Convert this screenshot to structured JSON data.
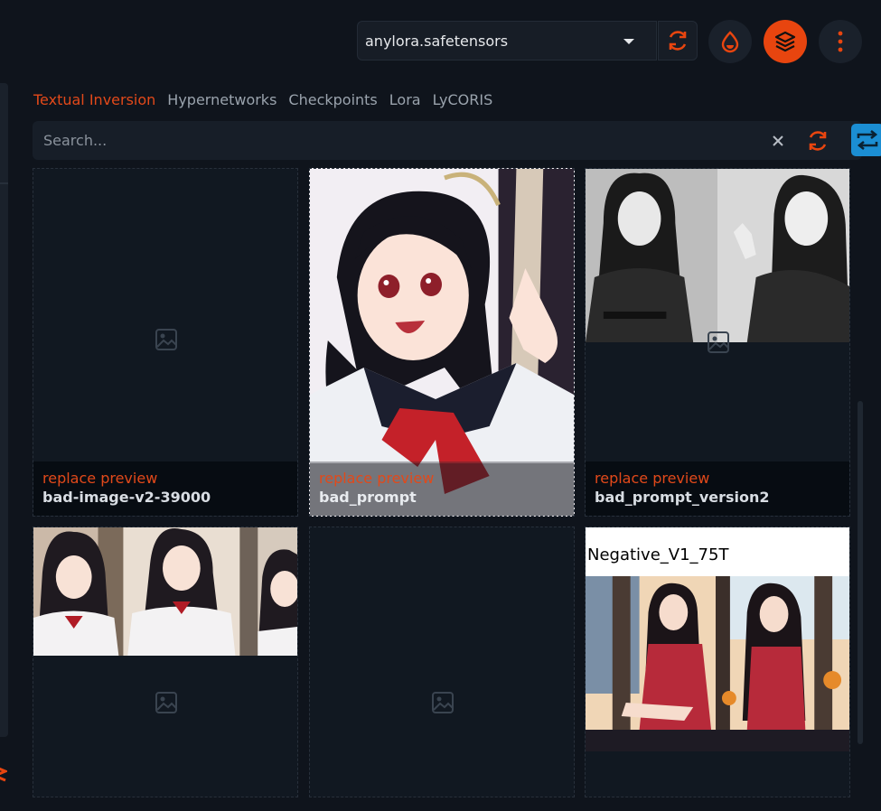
{
  "header": {
    "model_value": "anylora.safetensors",
    "model_refresh_icon": "refresh-icon",
    "buttons": [
      {
        "icon": "droplet-icon",
        "active": false
      },
      {
        "icon": "layers-icon",
        "active": true
      },
      {
        "icon": "more-vertical-icon",
        "active": false
      }
    ]
  },
  "tabs": [
    {
      "label": "Textual Inversion",
      "active": true
    },
    {
      "label": "Hypernetworks",
      "active": false
    },
    {
      "label": "Checkpoints",
      "active": false
    },
    {
      "label": "Lora",
      "active": false
    },
    {
      "label": "LyCORIS",
      "active": false
    }
  ],
  "search": {
    "placeholder": "Search...",
    "value": ""
  },
  "cards": [
    {
      "replace_label": "replace preview",
      "title": "bad-image-v2-39000"
    },
    {
      "replace_label": "replace preview",
      "title": "bad_prompt"
    },
    {
      "replace_label": "replace preview",
      "title": "bad_prompt_version2"
    },
    {
      "replace_label": "",
      "title": ""
    },
    {
      "replace_label": "",
      "title": ""
    },
    {
      "replace_label": "",
      "title": "",
      "image_caption": "Negative_V1_75T"
    }
  ],
  "colors": {
    "accent": "#e2491a",
    "sort_button": "#1b8ed3",
    "background": "#0f141c"
  }
}
